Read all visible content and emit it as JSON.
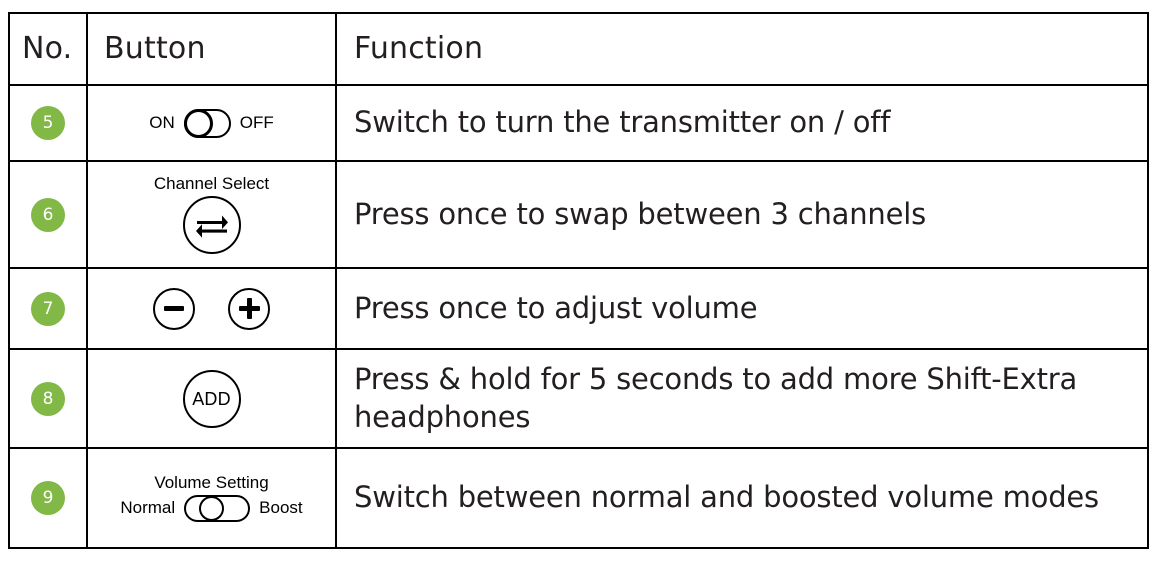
{
  "table": {
    "headers": [
      "No.",
      "Button",
      "Function"
    ],
    "rows": [
      {
        "no": "5",
        "button": {
          "type": "toggle",
          "left_label": "ON",
          "right_label": "OFF",
          "caption": ""
        },
        "function": "Switch to turn the transmitter on / off"
      },
      {
        "no": "6",
        "button": {
          "type": "circle-icon",
          "caption": "Channel Select",
          "icon": "swap-arrows-icon"
        },
        "function": "Press once to swap between 3 channels"
      },
      {
        "no": "7",
        "button": {
          "type": "plus-minus",
          "minus_label": "minus-icon",
          "plus_label": "plus-icon",
          "caption": ""
        },
        "function": "Press once to adjust volume"
      },
      {
        "no": "8",
        "button": {
          "type": "circle-text",
          "label": "ADD",
          "caption": ""
        },
        "function": "Press & hold for 5 seconds to add more Shift-Extra headphones"
      },
      {
        "no": "9",
        "button": {
          "type": "toggle",
          "caption": "Volume Setting",
          "left_label": "Normal",
          "right_label": "Boost"
        },
        "function": "Switch between normal and boosted volume modes"
      }
    ]
  },
  "colors": {
    "badge_green": "#81b846",
    "text": "#231f20",
    "border": "#000000"
  }
}
